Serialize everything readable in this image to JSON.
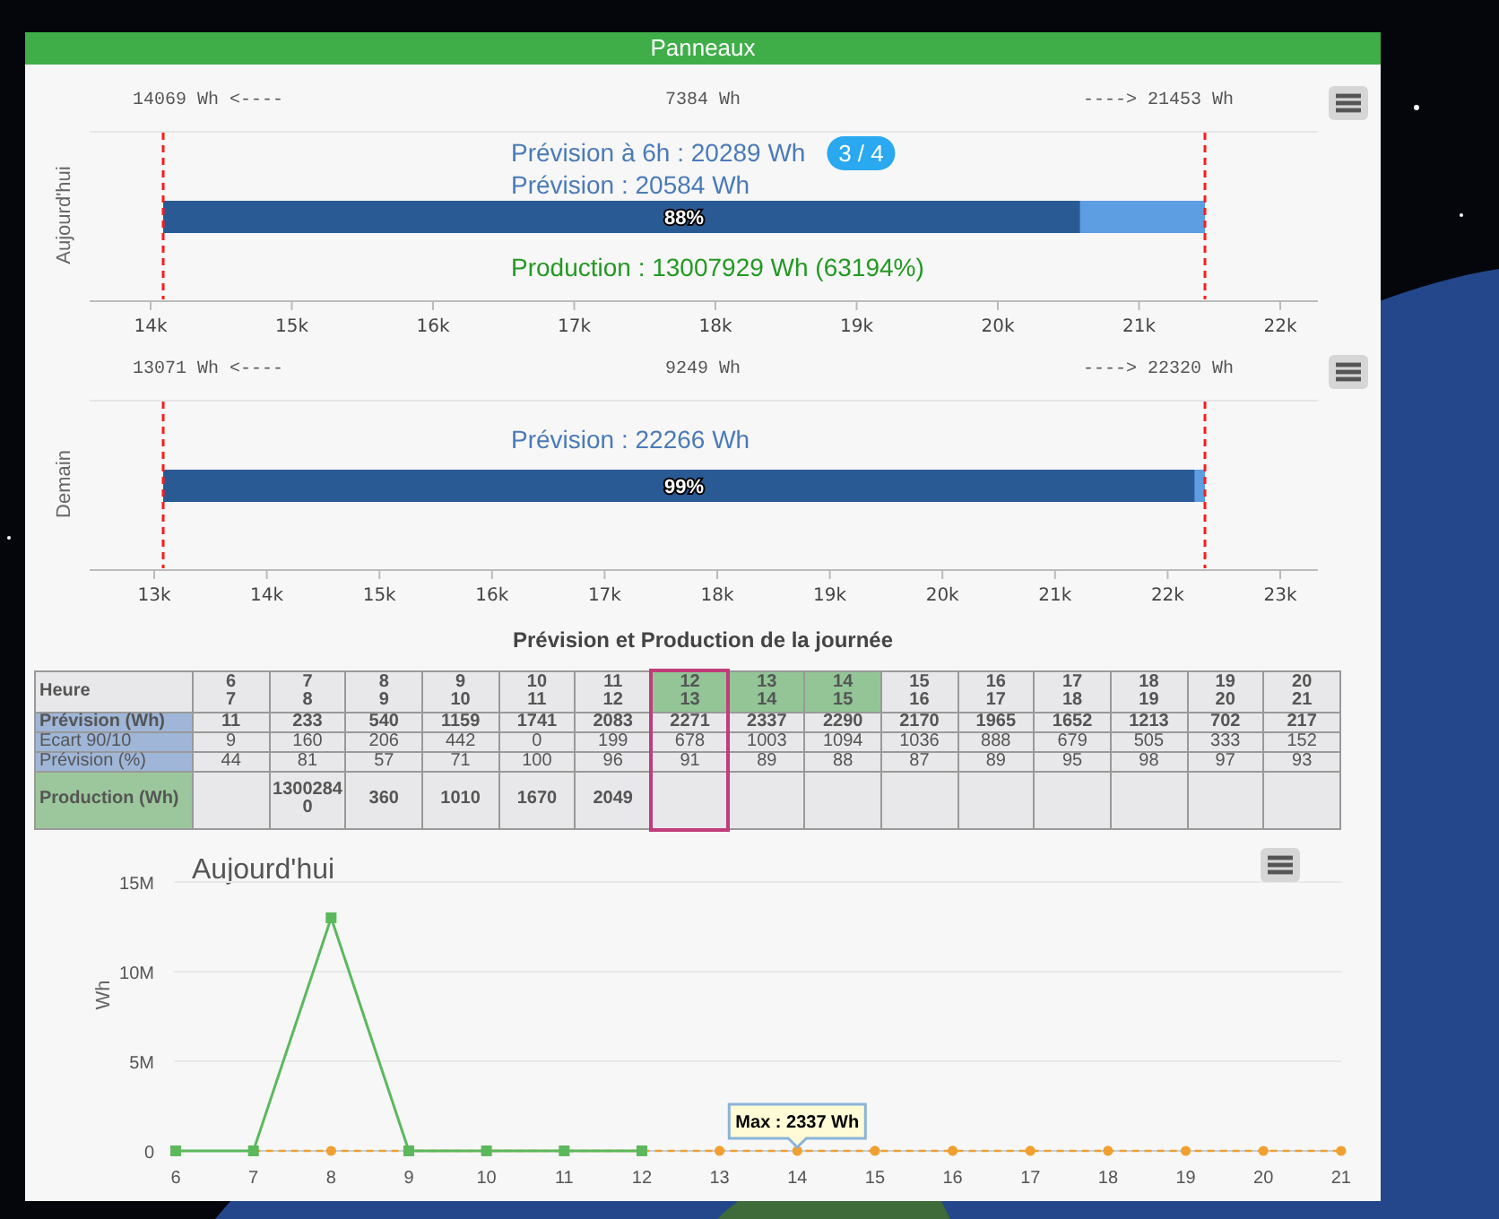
{
  "header": {
    "title": "Panneaux"
  },
  "gauges": [
    {
      "axis_title": "Aujourd'hui",
      "low": "14069 Wh <----",
      "span": "7384 Wh",
      "high": "----> 21453 Wh",
      "lines": [
        {
          "text": "Prévision à 6h : 20289 Wh",
          "badge": "3 / 4"
        },
        {
          "text": "Prévision : 20584 Wh"
        }
      ],
      "bar_label": "88%",
      "level": 0.88,
      "production": "Production : 13007929 Wh (63194%)",
      "ticks": [
        "14k",
        "15k",
        "16k",
        "17k",
        "18k",
        "19k",
        "20k",
        "21k",
        "22k"
      ]
    },
    {
      "axis_title": "Demain",
      "low": "13071 Wh <----",
      "span": "9249 Wh",
      "high": "----> 22320 Wh",
      "lines": [
        {
          "text": "Prévision : 22266 Wh"
        }
      ],
      "bar_label": "99%",
      "level": 0.99,
      "ticks": [
        "13k",
        "14k",
        "15k",
        "16k",
        "17k",
        "18k",
        "19k",
        "20k",
        "21k",
        "22k",
        "23k"
      ]
    }
  ],
  "table": {
    "title": "Prévision et Production de la journée",
    "corner": "Heure",
    "columns": [
      {
        "from": "6",
        "to": "7",
        "highlighted": false,
        "selected": false
      },
      {
        "from": "7",
        "to": "8",
        "highlighted": false,
        "selected": false
      },
      {
        "from": "8",
        "to": "9",
        "highlighted": false,
        "selected": false
      },
      {
        "from": "9",
        "to": "10",
        "highlighted": false,
        "selected": false
      },
      {
        "from": "10",
        "to": "11",
        "highlighted": false,
        "selected": false
      },
      {
        "from": "11",
        "to": "12",
        "highlighted": false,
        "selected": false
      },
      {
        "from": "12",
        "to": "13",
        "highlighted": true,
        "selected": true
      },
      {
        "from": "13",
        "to": "14",
        "highlighted": true,
        "selected": false
      },
      {
        "from": "14",
        "to": "15",
        "highlighted": true,
        "selected": false
      },
      {
        "from": "15",
        "to": "16",
        "highlighted": false,
        "selected": false
      },
      {
        "from": "16",
        "to": "17",
        "highlighted": false,
        "selected": false
      },
      {
        "from": "17",
        "to": "18",
        "highlighted": false,
        "selected": false
      },
      {
        "from": "18",
        "to": "19",
        "highlighted": false,
        "selected": false
      },
      {
        "from": "19",
        "to": "20",
        "highlighted": false,
        "selected": false
      },
      {
        "from": "20",
        "to": "21",
        "highlighted": false,
        "selected": false
      }
    ],
    "rows": [
      {
        "label": "Prévision (Wh)",
        "color": "#9fb6d8",
        "kind": "bold",
        "cells": [
          "11",
          "233",
          "540",
          "1159",
          "1741",
          "2083",
          "2271",
          "2337",
          "2290",
          "2170",
          "1965",
          "1652",
          "1213",
          "702",
          "217"
        ]
      },
      {
        "label": "Ecart 90/10",
        "color": "#9fb6d8",
        "kind": "plain",
        "cells": [
          "9",
          "160",
          "206",
          "442",
          "0",
          "199",
          "678",
          "1003",
          "1094",
          "1036",
          "888",
          "679",
          "505",
          "333",
          "152"
        ]
      },
      {
        "label": "Prévision (%)",
        "color": "#9fb6d8",
        "kind": "plain",
        "cells": [
          "44",
          "81",
          "57",
          "71",
          "100",
          "96",
          "91",
          "89",
          "88",
          "87",
          "89",
          "95",
          "98",
          "97",
          "93"
        ]
      },
      {
        "label": "Production (Wh)",
        "color": "#9cc79c",
        "kind": "tall",
        "cells": [
          "",
          "13002840",
          "360",
          "1010",
          "1670",
          "2049",
          "",
          "",
          "",
          "",
          "",
          "",
          "",
          "",
          ""
        ]
      }
    ]
  },
  "chart": {
    "chart_data": {
      "type": "line",
      "title": "Aujourd'hui",
      "ylabel": "Wh",
      "x": [
        "6",
        "7",
        "8",
        "9",
        "10",
        "11",
        "12",
        "13",
        "14",
        "15",
        "16",
        "17",
        "18",
        "19",
        "20",
        "21"
      ],
      "ylim": [
        0,
        15000000
      ],
      "yticks": [
        {
          "value": 0,
          "label": "0"
        },
        {
          "value": 5000000,
          "label": "5M"
        },
        {
          "value": 10000000,
          "label": "10M"
        },
        {
          "value": 15000000,
          "label": "15M"
        }
      ],
      "series": [
        {
          "color": "#5cb85c",
          "marker": "square",
          "line_style": "solid",
          "values": [
            0,
            0,
            13002840,
            360,
            1010,
            1670,
            2049,
            null,
            null,
            null,
            null,
            null,
            null,
            null,
            null,
            null
          ]
        },
        {
          "color": "#f0a030",
          "marker": "circle",
          "line_style": "dashed",
          "values": [
            null,
            11,
            233,
            540,
            1159,
            1741,
            2083,
            2271,
            2337,
            2290,
            2170,
            1965,
            1652,
            1213,
            702,
            217
          ]
        }
      ],
      "annotations": [
        "Max : 2337 Wh"
      ]
    }
  }
}
